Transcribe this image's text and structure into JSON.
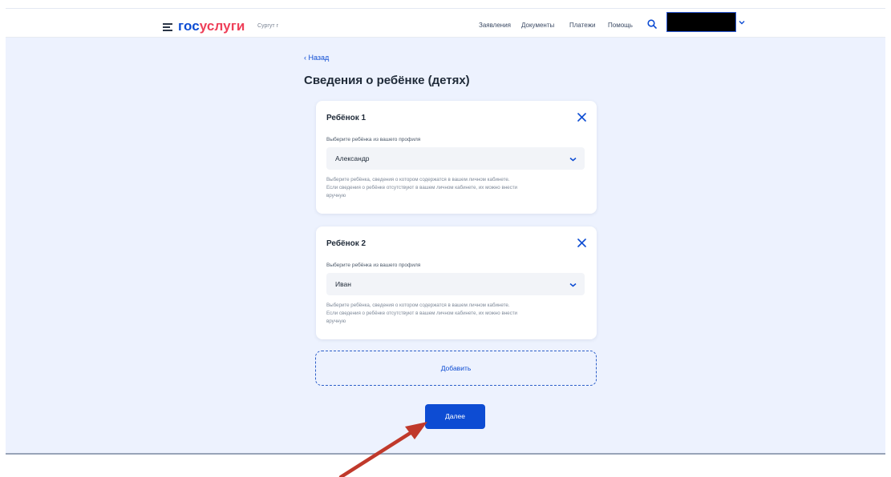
{
  "header": {
    "logo_part1": "гос",
    "logo_part2": "услуги",
    "city": "Сургут г",
    "nav": [
      "Заявления",
      "Документы",
      "Платежи",
      "Помощь"
    ]
  },
  "page": {
    "back_label": "Назад",
    "title": "Сведения о ребёнке (детях)"
  },
  "cards": [
    {
      "title": "Ребёнок 1",
      "select_label": "Выберите ребёнка из вашего профиля",
      "selected": "Александр",
      "hint_line1": "Выберите ребёнка, сведения о котором содержатся в вашем личном кабинете.",
      "hint_line2": "Если сведения о ребёнке отсутствуют в вашем личном кабинете, их можно внести",
      "hint_line3": "вручную"
    },
    {
      "title": "Ребёнок 2",
      "select_label": "Выберите ребёнка из вашего профиля",
      "selected": "Иван",
      "hint_line1": "Выберите ребёнка, сведения о котором содержатся в вашем личном кабинете.",
      "hint_line2": "Если сведения о ребёнке отсутствуют в вашем личном кабинете, их можно внести",
      "hint_line3": "вручную"
    }
  ],
  "actions": {
    "add_label": "Добавить",
    "next_label": "Далее"
  },
  "colors": {
    "brand_blue": "#0d4cd3",
    "brand_red": "#ee3f58",
    "background": "#edf2fe",
    "annotation_arrow": "#c0392b"
  },
  "icons": [
    "menu-icon",
    "search-icon",
    "chevron-down-icon",
    "close-icon",
    "chevron-left-icon"
  ]
}
